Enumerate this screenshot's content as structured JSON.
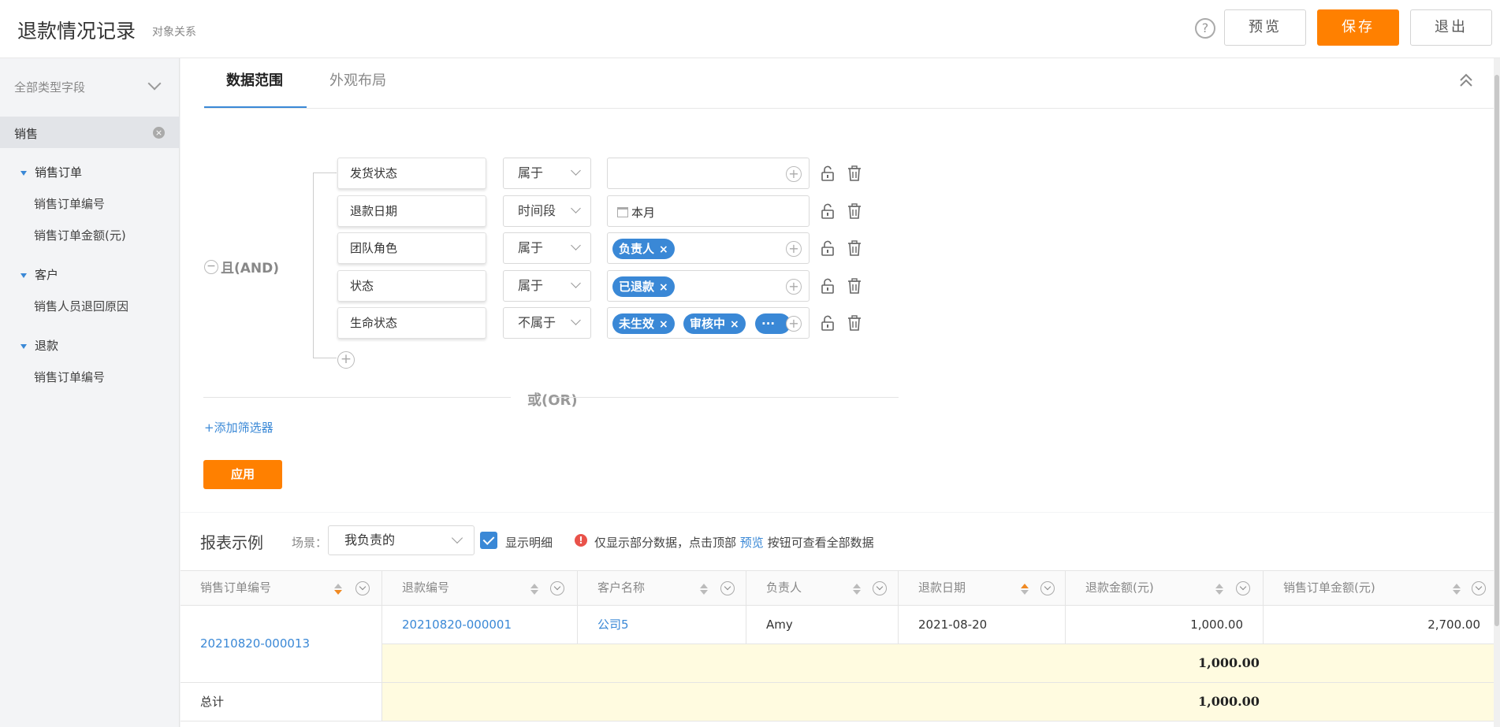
{
  "header": {
    "title": "退款情况记录",
    "subtitle": "对象关系",
    "preview_label": "预览",
    "save_label": "保存",
    "exit_label": "退出"
  },
  "sidebar": {
    "filter_label": "全部类型字段",
    "tab_label": "销售",
    "groups": [
      {
        "label": "销售订单",
        "items": [
          "销售订单编号",
          "销售订单金额(元)"
        ]
      },
      {
        "label": "客户",
        "items": [
          "销售人员退回原因"
        ]
      },
      {
        "label": "退款",
        "items": [
          "销售订单编号"
        ]
      }
    ]
  },
  "tabs": {
    "data_range": "数据范围",
    "appearance": "外观布局"
  },
  "filter": {
    "logic_and": "且(AND)",
    "logic_or": "或(OR)",
    "add_filter_label": "+添加筛选器",
    "apply_label": "应用",
    "conditions": [
      {
        "field": "发货状态",
        "operator": "属于",
        "value": "",
        "chips": []
      },
      {
        "field": "退款日期",
        "operator": "时间段",
        "value": "本月",
        "chips": []
      },
      {
        "field": "团队角色",
        "operator": "属于",
        "value": "",
        "chips": [
          "负责人"
        ]
      },
      {
        "field": "状态",
        "operator": "属于",
        "value": "",
        "chips": [
          "已退款"
        ]
      },
      {
        "field": "生命状态",
        "operator": "不属于",
        "value": "",
        "chips": [
          "未生效",
          "审核中",
          "···"
        ]
      }
    ],
    "chip_close": "×"
  },
  "report": {
    "title": "报表示例",
    "scene_label": "场景：",
    "scene_value": "我负责的",
    "show_detail_label": "显示明细",
    "notice_prefix": "仅显示部分数据，点击顶部",
    "notice_link": "预览",
    "notice_suffix": "按钮可查看全部数据",
    "columns": [
      "销售订单编号",
      "退款编号",
      "客户名称",
      "负责人",
      "退款日期",
      "退款金额(元)",
      "销售订单金额(元)"
    ],
    "rows": [
      {
        "order_no": "20210820-000013",
        "refund_no": "20210820-000001",
        "customer": "公司5",
        "owner": "Amy",
        "refund_date": "2021-08-20",
        "refund_amount": "1,000.00",
        "order_amount": "2,700.00",
        "subtotal": "1,000.00"
      }
    ],
    "total_label": "总计",
    "total_value": "1,000.00"
  },
  "colors": {
    "accent": "#ff8000",
    "primary": "#3a88d6",
    "highlight_row": "#fffbe0"
  }
}
